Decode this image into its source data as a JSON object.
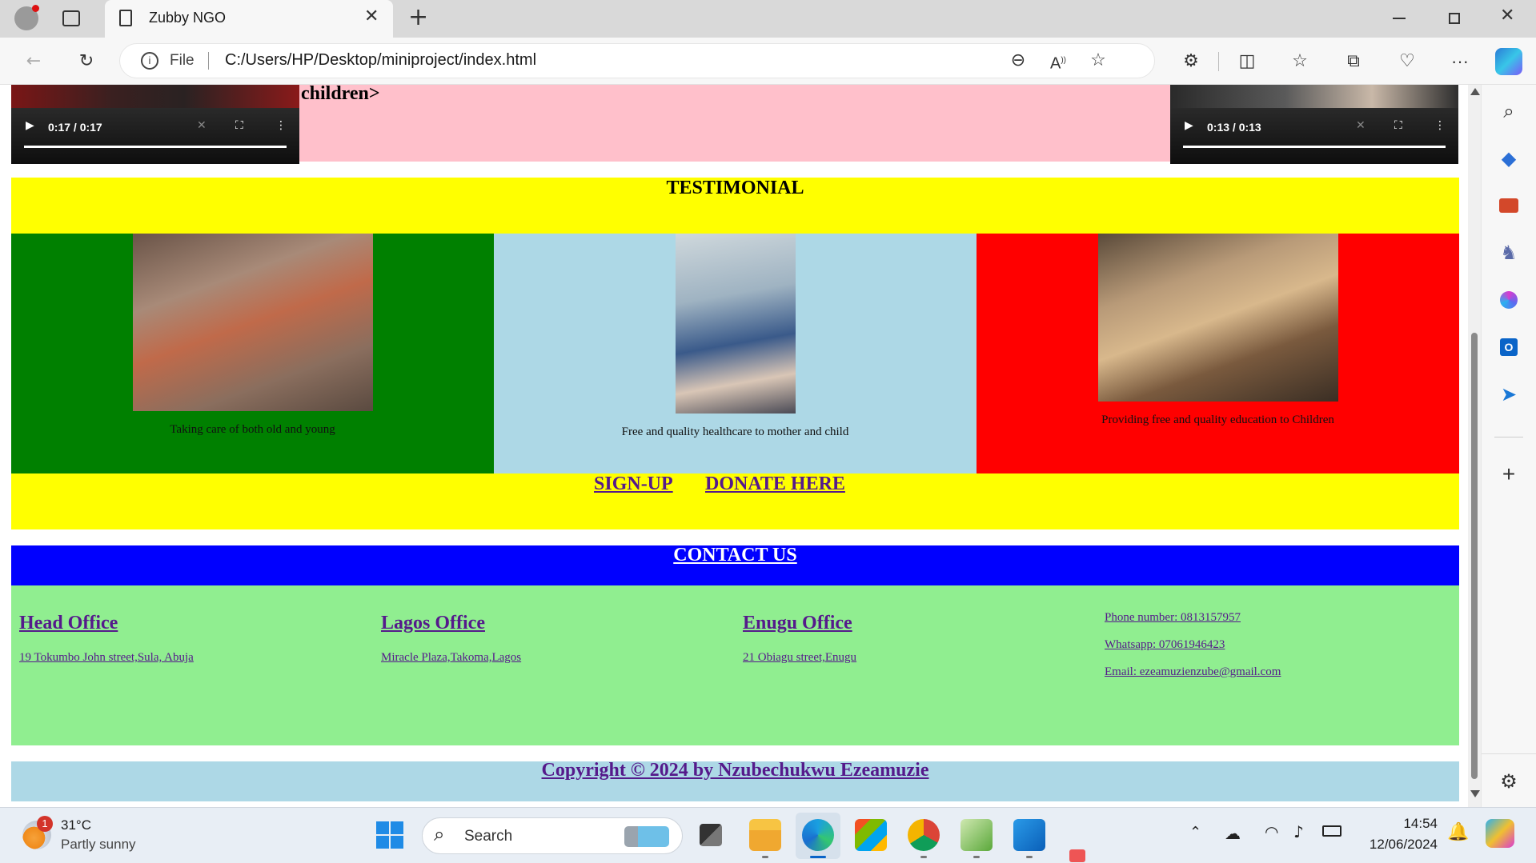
{
  "browser": {
    "tab_title": "Zubby NGO",
    "address_prefix": "File",
    "url": "C:/Users/HP/Desktop/miniproject/index.html"
  },
  "page": {
    "top_text": "children>",
    "video_left": {
      "time": "0:17 / 0:17"
    },
    "video_right": {
      "time": "0:13 / 0:13"
    },
    "testimonial": {
      "heading": "TESTIMONIAL",
      "items": [
        {
          "caption": "Taking care of both old and young",
          "bg": "#008000"
        },
        {
          "caption": "Free and quality healthcare to mother and child",
          "bg": "#add8e6"
        },
        {
          "caption": "Providing free and quality education to Children",
          "bg": "#ff0000"
        }
      ],
      "links": {
        "signup": "SIGN-UP",
        "donate": "DONATE HERE"
      }
    },
    "contact": {
      "heading": "CONTACT US",
      "offices": [
        {
          "title": "Head Office",
          "address": "19 Tokumbo John street,Sula, Abuja"
        },
        {
          "title": "Lagos Office",
          "address": "Miracle Plaza,Takoma,Lagos"
        },
        {
          "title": "Enugu Office",
          "address": "21 Obiagu street,Enugu"
        }
      ],
      "phone": "Phone number: 0813157957",
      "whatsapp": "Whatsapp: 07061946423",
      "email": "Email: ezeamuzienzube@gmail.com"
    },
    "copyright": "Copyright © 2024 by Nzubechukwu Ezeamuzie"
  },
  "taskbar": {
    "weather_temp": "31°C",
    "weather_desc": "Partly sunny",
    "weather_badge": "1",
    "search_placeholder": "Search",
    "time": "14:54",
    "date": "12/06/2024"
  },
  "colors": {
    "yellow": "#ffff00",
    "blue": "#0000ff",
    "lightgreen": "#90ee90",
    "pink": "#ffc0cb",
    "lightblue": "#add8e6"
  }
}
